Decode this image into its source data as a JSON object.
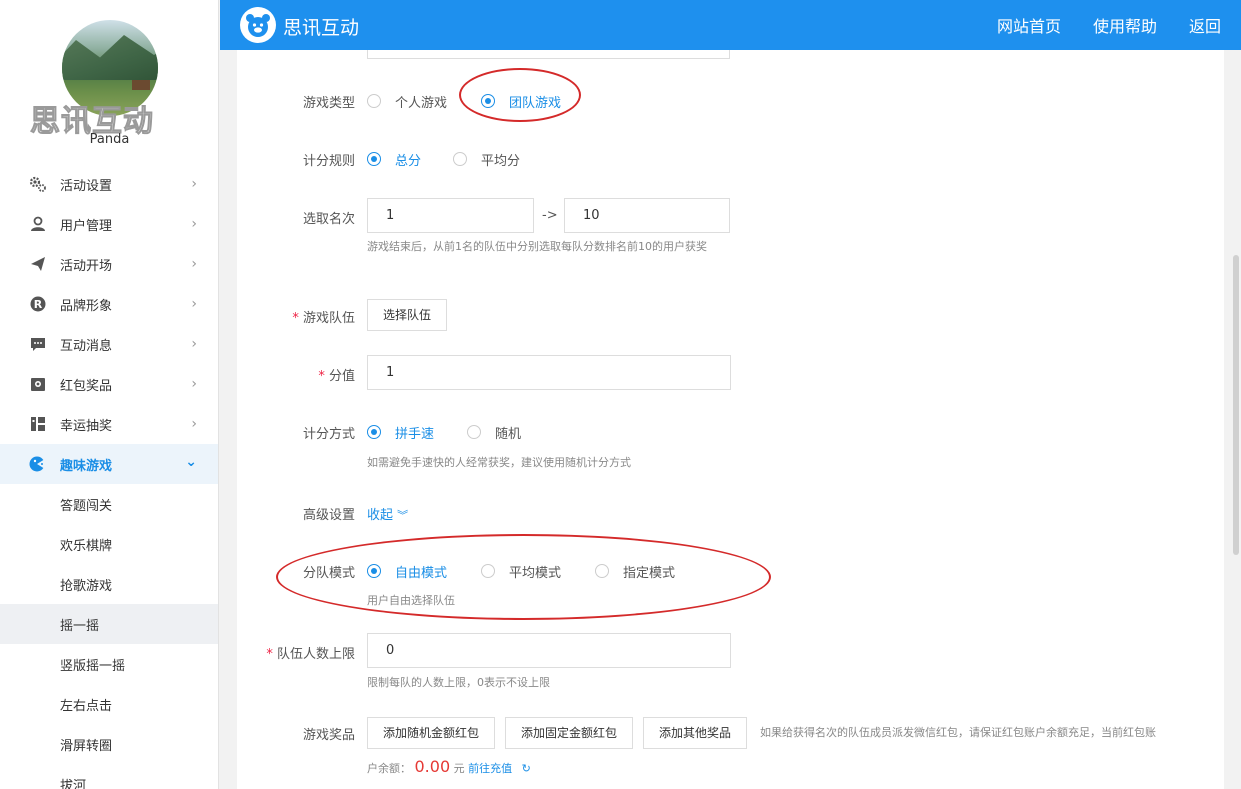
{
  "sidebar": {
    "watermark": "思讯互动",
    "username": "Panda",
    "menu": [
      {
        "label": "活动设置",
        "icon": "gears-icon"
      },
      {
        "label": "用户管理",
        "icon": "user-icon"
      },
      {
        "label": "活动开场",
        "icon": "paper-plane-icon"
      },
      {
        "label": "品牌形象",
        "icon": "registered-icon"
      },
      {
        "label": "互动消息",
        "icon": "chat-icon"
      },
      {
        "label": "红包奖品",
        "icon": "gift-icon"
      },
      {
        "label": "幸运抽奖",
        "icon": "lottery-icon"
      },
      {
        "label": "趣味游戏",
        "icon": "game-icon"
      }
    ],
    "submenu": [
      "答题闯关",
      "欢乐棋牌",
      "抢歌游戏",
      "摇一摇",
      "竖版摇一摇",
      "左右点击",
      "滑屏转圈",
      "拔河"
    ],
    "active_sub": "摇一摇"
  },
  "header": {
    "title": "思讯互动",
    "links": [
      "网站首页",
      "使用帮助",
      "返回"
    ]
  },
  "form": {
    "game_type": {
      "label": "游戏类型",
      "options": [
        "个人游戏",
        "团队游戏"
      ],
      "selected": "团队游戏"
    },
    "score_rule": {
      "label": "计分规则",
      "options": [
        "总分",
        "平均分"
      ],
      "selected": "总分"
    },
    "rank": {
      "label": "选取名次",
      "from": "1",
      "sep": "->",
      "to": "10",
      "hint": "游戏结束后，从前1名的队伍中分别选取每队分数排名前10的用户获奖"
    },
    "team": {
      "required": "*",
      "label": "游戏队伍",
      "button": "选择队伍"
    },
    "score_value": {
      "required": "*",
      "label": "分值",
      "value": "1"
    },
    "score_method": {
      "label": "计分方式",
      "options": [
        "拼手速",
        "随机"
      ],
      "selected": "拼手速",
      "hint": "如需避免手速快的人经常获奖，建议使用随机计分方式"
    },
    "advanced": {
      "label": "高级设置",
      "toggle": "收起"
    },
    "team_mode": {
      "label": "分队模式",
      "options": [
        "自由模式",
        "平均模式",
        "指定模式"
      ],
      "selected": "自由模式",
      "hint": "用户自由选择队伍"
    },
    "team_limit": {
      "required": "*",
      "label": "队伍人数上限",
      "value": "0",
      "hint": "限制每队的人数上限，0表示不设上限"
    },
    "prize": {
      "label": "游戏奖品",
      "buttons": [
        "添加随机金额红包",
        "添加固定金额红包",
        "添加其他奖品"
      ],
      "notice": "如果给获得名次的队伍成员派发微信红包，请保证红包账户余额充足，当前红包账",
      "balance_label": "户余额：",
      "balance": "0.00",
      "currency": "元",
      "recharge": "前往充值"
    }
  },
  "colors": {
    "primary": "#1e90ee",
    "link": "#1a8ee6",
    "annotation": "#d42a2a",
    "balance": "#e53935"
  }
}
